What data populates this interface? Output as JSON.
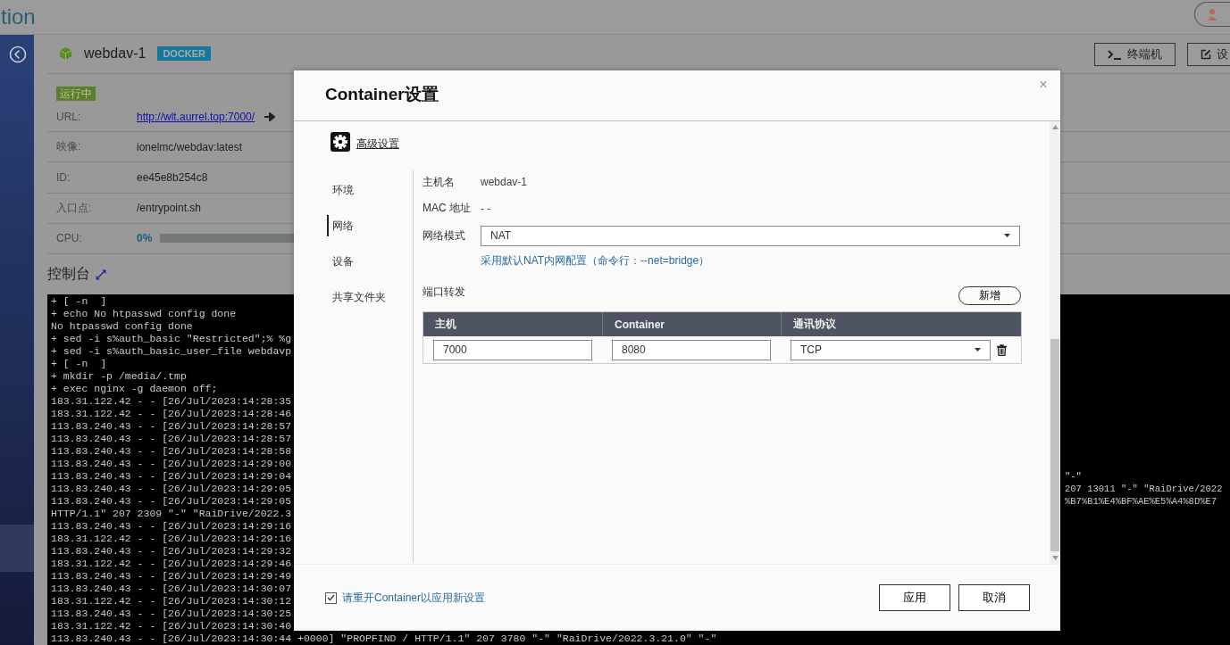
{
  "app_title": "tion",
  "container": {
    "name": "webdav-1",
    "badge": "DOCKER",
    "status": "运行中",
    "buttons": [
      {
        "label": "终端机",
        "kind": "terminal"
      },
      {
        "label": "设",
        "kind": "edit"
      }
    ],
    "fields": [
      {
        "label": "URL:",
        "value": "http://wlt.aurrel.top:7000/",
        "kind": "link"
      },
      {
        "label": "映像:",
        "value": "ionelmc/webdav:latest",
        "kind": "text"
      },
      {
        "label": "ID:",
        "value": "ee45e8b254c8",
        "kind": "text"
      },
      {
        "label": "入口点:",
        "value": "/entrypoint.sh",
        "kind": "text"
      },
      {
        "label": "CPU:",
        "value": "0%",
        "kind": "meter"
      }
    ]
  },
  "console": {
    "title": "控制台",
    "rows": [
      {
        "left": "+ [ -n  ]"
      },
      {
        "left": "+ echo No htpasswd config done"
      },
      {
        "left": "No htpasswd config done"
      },
      {
        "left": "+ sed -i s%auth_basic \"Restricted\";% %g"
      },
      {
        "left": "+ sed -i s%auth_basic_user_file webdavp"
      },
      {
        "left": "+ [ -n  ]"
      },
      {
        "left": "+ mkdir -p /media/.tmp"
      },
      {
        "left": "+ exec nginx -g daemon off;"
      },
      {
        "left": "183.31.122.42 - - [26/Jul/2023:14:28:35"
      },
      {
        "left": "183.31.122.42 - - [26/Jul/2023:14:28:46"
      },
      {
        "left": "113.83.240.43 - - [26/Jul/2023:14:28:57"
      },
      {
        "left": "113.83.240.43 - - [26/Jul/2023:14:28:57"
      },
      {
        "left": "113.83.240.43 - - [26/Jul/2023:14:28:58"
      },
      {
        "left": "113.83.240.43 - - [26/Jul/2023:14:29:00"
      },
      {
        "left": "113.83.240.43 - - [26/Jul/2023:14:29:04",
        "right": "\"-\""
      },
      {
        "left": "113.83.240.43 - - [26/Jul/2023:14:29:05",
        "right": "207 13011 \"-\" \"RaiDrive/2022"
      },
      {
        "left": "113.83.240.43 - - [26/Jul/2023:14:29:05",
        "right": "%B7%B1%E4%BF%AE%E5%A4%8D%E7"
      },
      {
        "left": "HTTP/1.1\" 207 2309 \"-\" \"RaiDrive/2022.3"
      },
      {
        "left": "113.83.240.43 - - [26/Jul/2023:14:29:16"
      },
      {
        "left": "183.31.122.42 - - [26/Jul/2023:14:29:16"
      },
      {
        "left": "113.83.240.43 - - [26/Jul/2023:14:29:32"
      },
      {
        "left": "183.31.122.42 - - [26/Jul/2023:14:29:46"
      },
      {
        "left": "113.83.240.43 - - [26/Jul/2023:14:29:49"
      },
      {
        "left": "113.83.240.43 - - [26/Jul/2023:14:30:07"
      },
      {
        "left": "183.31.122.42 - - [26/Jul/2023:14:30:12"
      },
      {
        "left": "113.83.240.43 - - [26/Jul/2023:14:30:25"
      },
      {
        "left": "183.31.122.42 - - [26/Jul/2023:14:30:40"
      }
    ],
    "last_line": "113.83.240.43 - - [26/Jul/2023:14:30:44 +0000] \"PROPFIND / HTTP/1.1\" 207 3780 \"-\" \"RaiDrive/2022.3.21.0\" \"-\""
  },
  "dialog": {
    "title": "Container设置",
    "close": "×",
    "advanced_link": "高级设置",
    "nav": [
      {
        "label": "环境",
        "selected": false
      },
      {
        "label": "网络",
        "selected": true
      },
      {
        "label": "设备",
        "selected": false
      },
      {
        "label": "共享文件夹",
        "selected": false
      }
    ],
    "hostname": {
      "label": "主机名",
      "value": "webdav-1"
    },
    "mac": {
      "label": "MAC 地址",
      "value": "- -"
    },
    "network_mode": {
      "label": "网络模式",
      "value": "NAT",
      "hint": "采用默认NAT内网配置（命令行：--net=bridge）"
    },
    "port_forwarding": {
      "label": "端口转发",
      "add_button": "新增",
      "columns": [
        "主机",
        "Container",
        "通讯协议"
      ],
      "rows": [
        {
          "host": "7000",
          "container": "8080",
          "protocol": "TCP"
        }
      ]
    },
    "restart_notice": {
      "label": "请重开Container以应用新设置",
      "checked": true
    },
    "buttons": [
      "应用",
      "取消"
    ]
  }
}
